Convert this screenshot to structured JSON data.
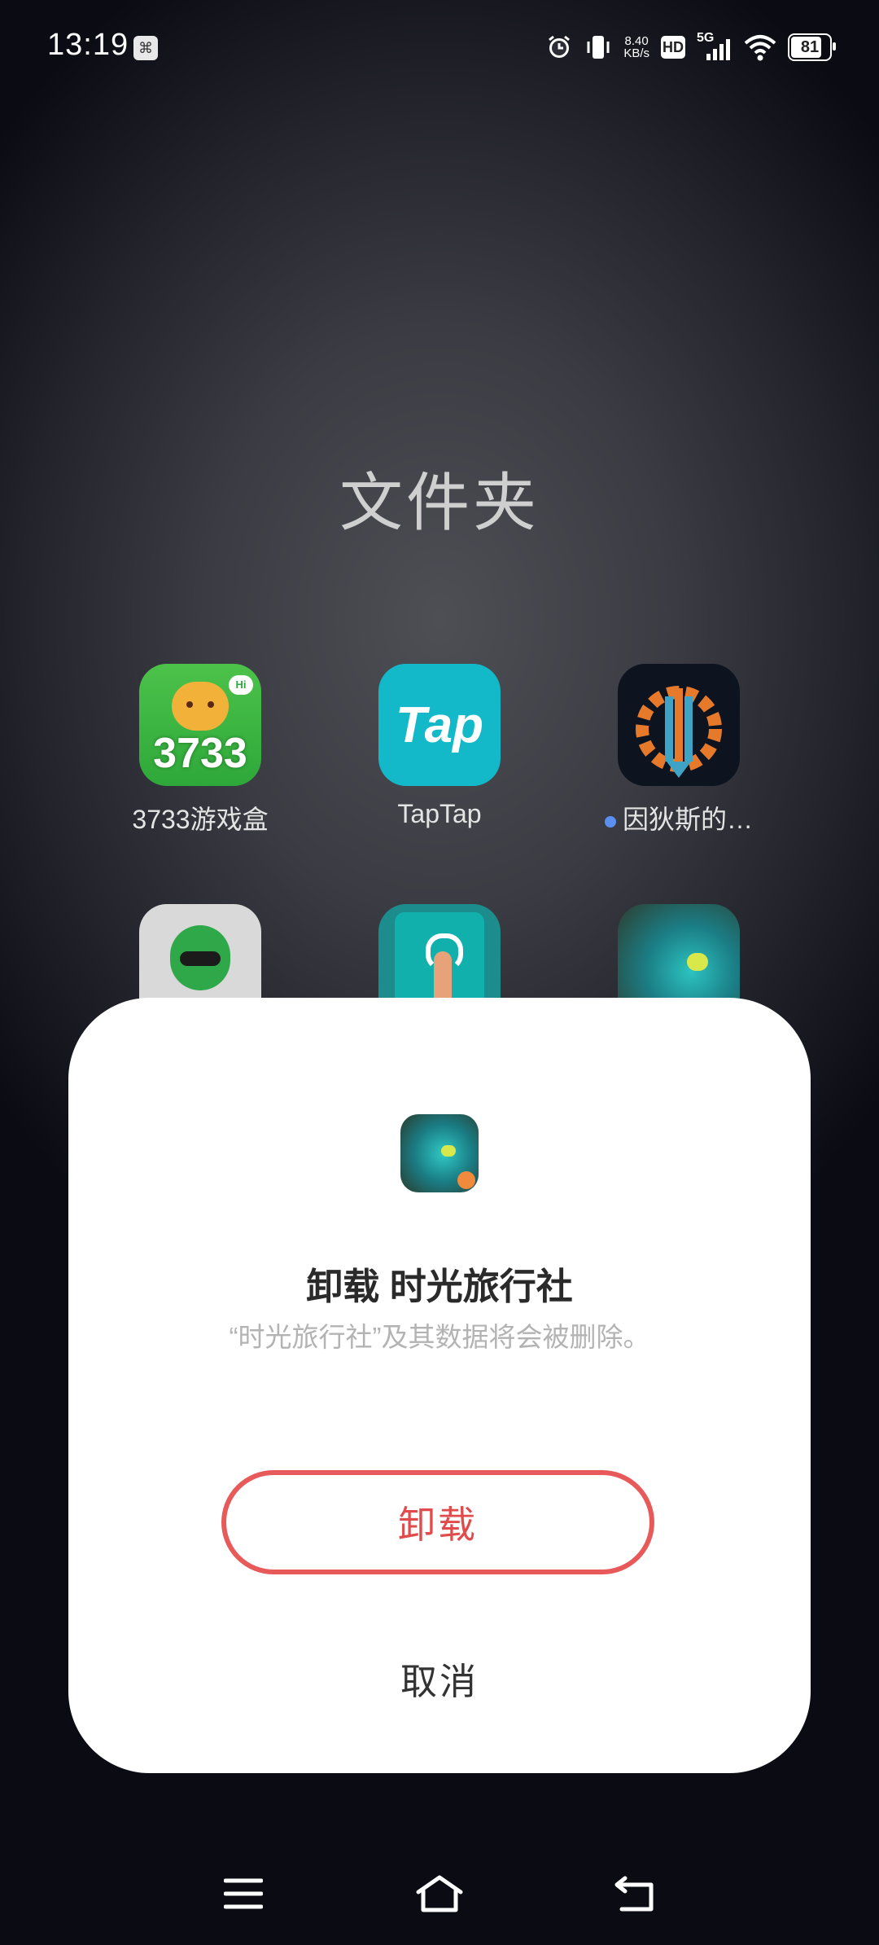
{
  "status_bar": {
    "time": "13:19",
    "sim_icon": "sim-card-icon",
    "net_speed_value": "8.40",
    "net_speed_unit": "KB/s",
    "hd_label": "HD",
    "network_label": "5G",
    "battery_percent": 81
  },
  "folder": {
    "title": "文件夹",
    "apps": [
      {
        "label": "3733游戏盒",
        "icon_text": "3733"
      },
      {
        "label": "TapTap",
        "icon_text": "Tap"
      },
      {
        "label": "因狄斯的…",
        "new_dot": true
      }
    ]
  },
  "dialog": {
    "title": "卸载 时光旅行社",
    "subtitle": "“时光旅行社”及其数据将会被删除。",
    "uninstall_label": "卸载",
    "cancel_label": "取消",
    "accent_color": "#e85a5a"
  },
  "navbar": {
    "menu_icon": "menu-icon",
    "home_icon": "home-icon",
    "back_icon": "back-icon"
  }
}
